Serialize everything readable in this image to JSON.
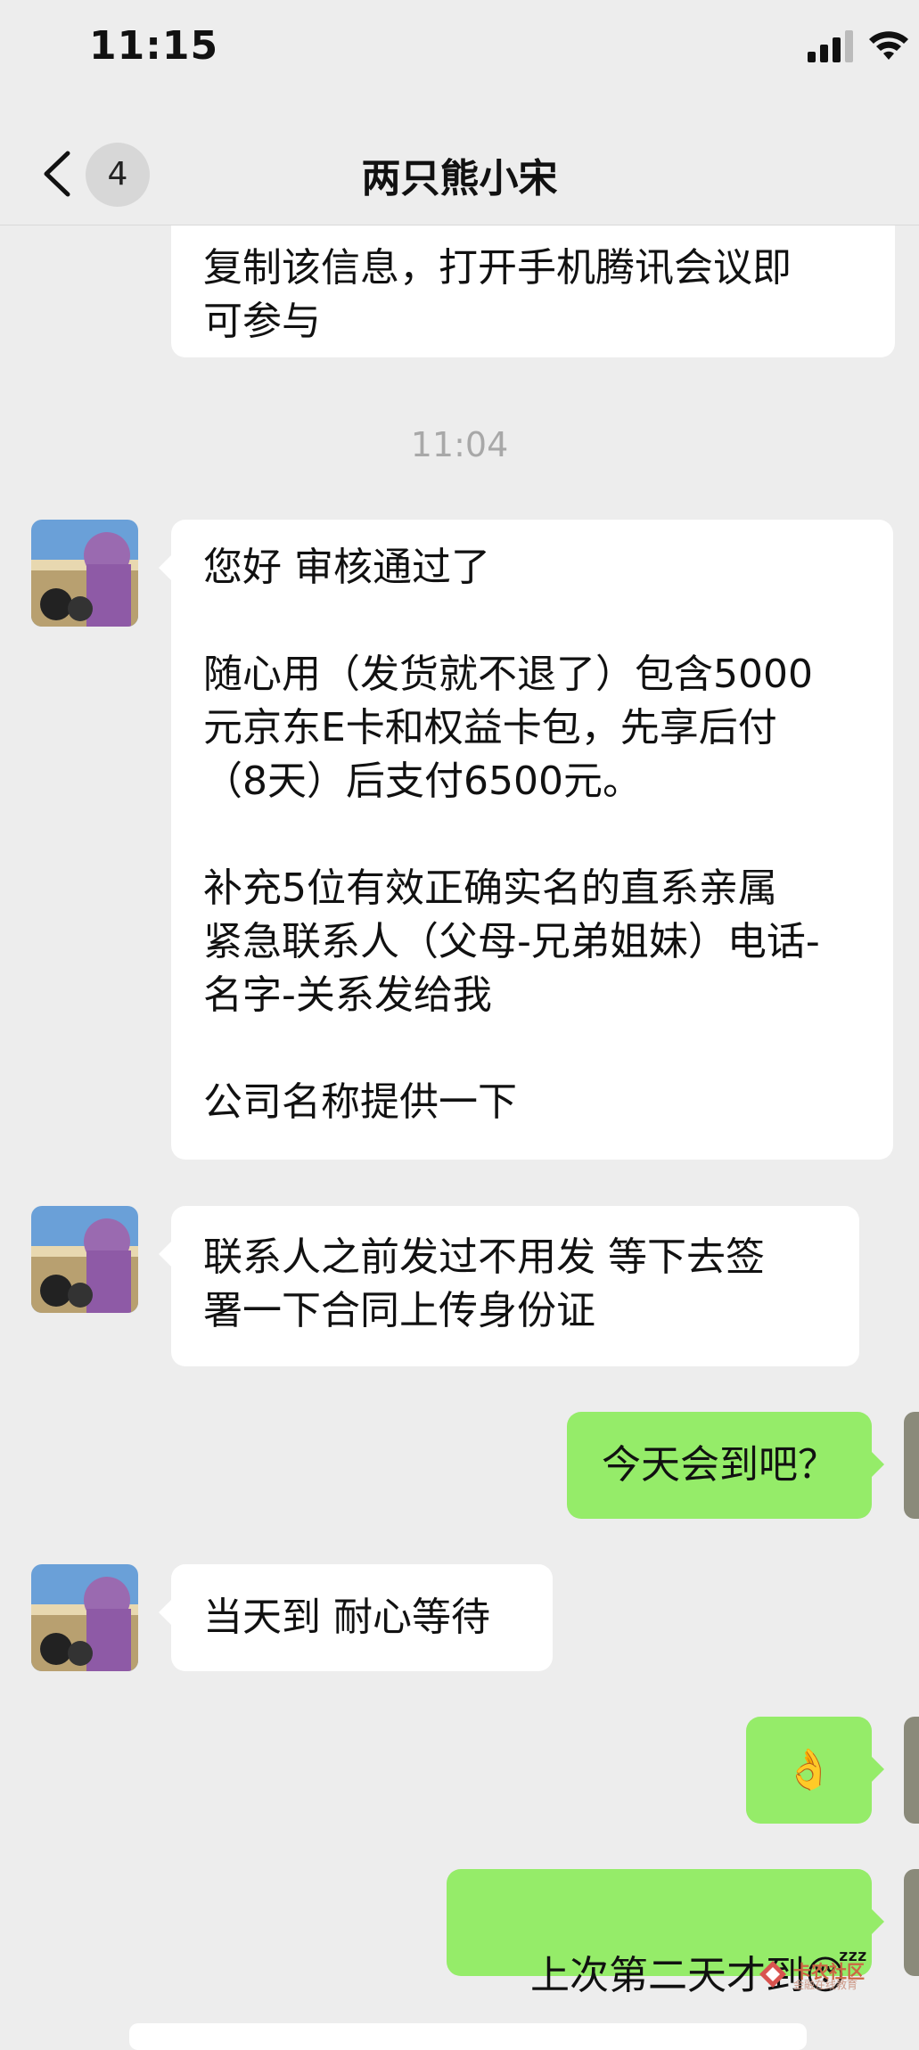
{
  "status_bar": {
    "time": "11:15"
  },
  "nav": {
    "unread_count": "4",
    "title": "两只熊小宋"
  },
  "messages": {
    "partial": "复制该信息，打开手机腾讯会议即\n可参与",
    "timestamp": "11:04",
    "m1": "您好 审核通过了\n\n随心用（发货就不退了）包含5000\n元京东E卡和权益卡包，先享后付\n（8天）后支付6500元。\n\n补充5位有效正确实名的直系亲属\n紧急联系人（父母-兄弟姐妹）电话-\n名字-关系发给我\n\n公司名称提供一下",
    "m2": "联系人之前发过不用发 等下去签\n署一下合同上传身份证",
    "m3": "今天会到吧？",
    "m4": "当天到 耐心等待",
    "m5": "👌",
    "m6_text": "上次第二天才到",
    "m6_emoji": "😴"
  },
  "watermark": {
    "name": "卡农社区",
    "sub": "金融在线教育"
  }
}
